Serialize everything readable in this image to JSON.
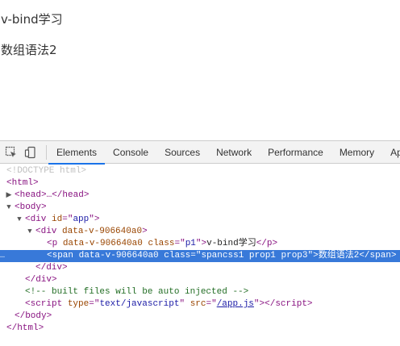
{
  "page": {
    "p1_text": "v-bind学习",
    "span_text": "数组语法2"
  },
  "devtools": {
    "tabs": [
      {
        "label": "Elements",
        "active": true
      },
      {
        "label": "Console"
      },
      {
        "label": "Sources"
      },
      {
        "label": "Network"
      },
      {
        "label": "Performance"
      },
      {
        "label": "Memory"
      },
      {
        "label": "App"
      }
    ],
    "tree": {
      "doctype": "<!DOCTYPE html>",
      "html_open": "<html>",
      "head": "<head>…</head>",
      "body_open": "<body>",
      "div_app_tag": "div",
      "div_app_attr": "id",
      "div_app_val": "app",
      "div_inner_tag": "div",
      "div_inner_attr": "data-v-906640a0",
      "p_tag": "p",
      "p_attr1": "data-v-906640a0",
      "p_attr2": "class",
      "p_class": "p1",
      "p_text": "v-bind学习",
      "span_tag": "span",
      "span_attr1": "data-v-906640a0",
      "span_attr2": "class",
      "span_class": "spancss1 prop1 prop3",
      "span_text": "数组语法2",
      "div_close": "</div>",
      "comment": "<!-- built files will be auto injected -->",
      "script_tag": "script",
      "script_type_attr": "type",
      "script_type_val": "text/javascript",
      "script_src_attr": "src",
      "script_src_val": "/app.js",
      "body_close": "</body>",
      "html_close": "</html>"
    }
  }
}
